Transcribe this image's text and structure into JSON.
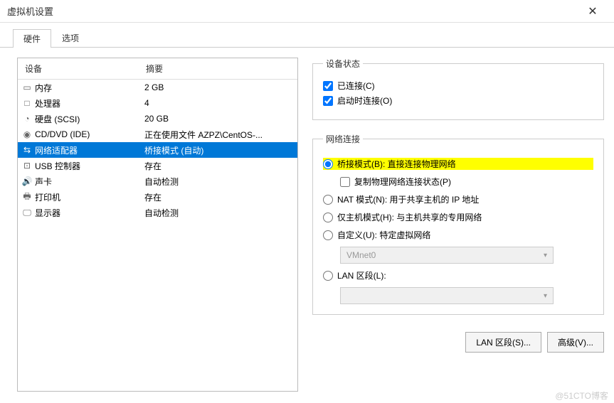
{
  "title": "虚拟机设置",
  "tabs": {
    "hardware": "硬件",
    "options": "选项"
  },
  "headers": {
    "device": "设备",
    "summary": "摘要"
  },
  "devices": [
    {
      "icon": "▭",
      "name": "内存",
      "summary": "2 GB"
    },
    {
      "icon": "□",
      "name": "处理器",
      "summary": "4"
    },
    {
      "icon": "◔",
      "name": "硬盘 (SCSI)",
      "summary": "20 GB"
    },
    {
      "icon": "◉",
      "name": "CD/DVD (IDE)",
      "summary": "正在使用文件 AZPZ\\CentOS-..."
    },
    {
      "icon": "⇆",
      "name": "网络适配器",
      "summary": "桥接模式 (自动)"
    },
    {
      "icon": "⊡",
      "name": "USB 控制器",
      "summary": "存在"
    },
    {
      "icon": "🔊",
      "name": "声卡",
      "summary": "自动检测"
    },
    {
      "icon": "🖶",
      "name": "打印机",
      "summary": "存在"
    },
    {
      "icon": "🖵",
      "name": "显示器",
      "summary": "自动检测"
    }
  ],
  "deviceStatus": {
    "legend": "设备状态",
    "connected": "已连接(C)",
    "connectAtPowerOn": "启动时连接(O)"
  },
  "network": {
    "legend": "网络连接",
    "bridged": "桥接模式(B): 直接连接物理网络",
    "replicate": "复制物理网络连接状态(P)",
    "nat": "NAT 模式(N): 用于共享主机的 IP 地址",
    "hostOnly": "仅主机模式(H): 与主机共享的专用网络",
    "custom": "自定义(U): 特定虚拟网络",
    "customValue": "VMnet0",
    "lanSegment": "LAN 区段(L):",
    "lanValue": ""
  },
  "buttons": {
    "lanSegments": "LAN 区段(S)...",
    "advanced": "高级(V)..."
  },
  "watermark": "@51CTO博客"
}
